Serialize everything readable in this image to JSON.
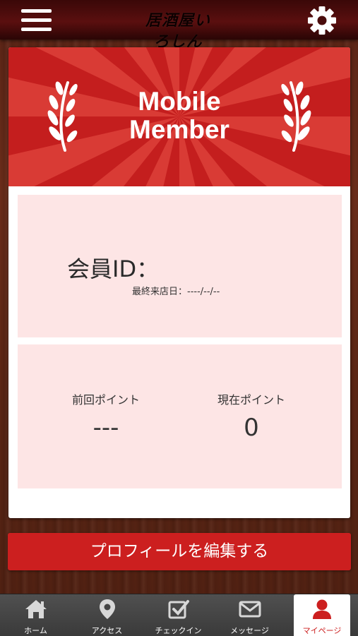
{
  "header": {
    "logo_text": "居酒屋いろしん",
    "menu_icon": "hamburger-menu-icon",
    "settings_icon": "gear-icon"
  },
  "banner": {
    "title": "Mobile\nMember",
    "left_icon": "laurel-left-icon",
    "right_icon": "laurel-right-icon",
    "color": "#c41e1e"
  },
  "member": {
    "id_label": "会員ID：",
    "last_visit": "最終来店日：----/--/--"
  },
  "points": {
    "previous_label": "前回ポイント",
    "previous_value": "---",
    "current_label": "現在ポイント",
    "current_value": "0"
  },
  "edit_profile_label": "プロフィールを編集する",
  "tabs": [
    {
      "label": "ホーム",
      "icon": "home-icon"
    },
    {
      "label": "アクセス",
      "icon": "map-pin-icon"
    },
    {
      "label": "チェックイン",
      "icon": "checkin-icon"
    },
    {
      "label": "メッセージ",
      "icon": "envelope-icon"
    },
    {
      "label": "マイページ",
      "icon": "user-icon",
      "active": true
    }
  ],
  "colors": {
    "accent": "#cc1f1f",
    "panel": "#fde5e5",
    "header": "#4a0c0c"
  }
}
